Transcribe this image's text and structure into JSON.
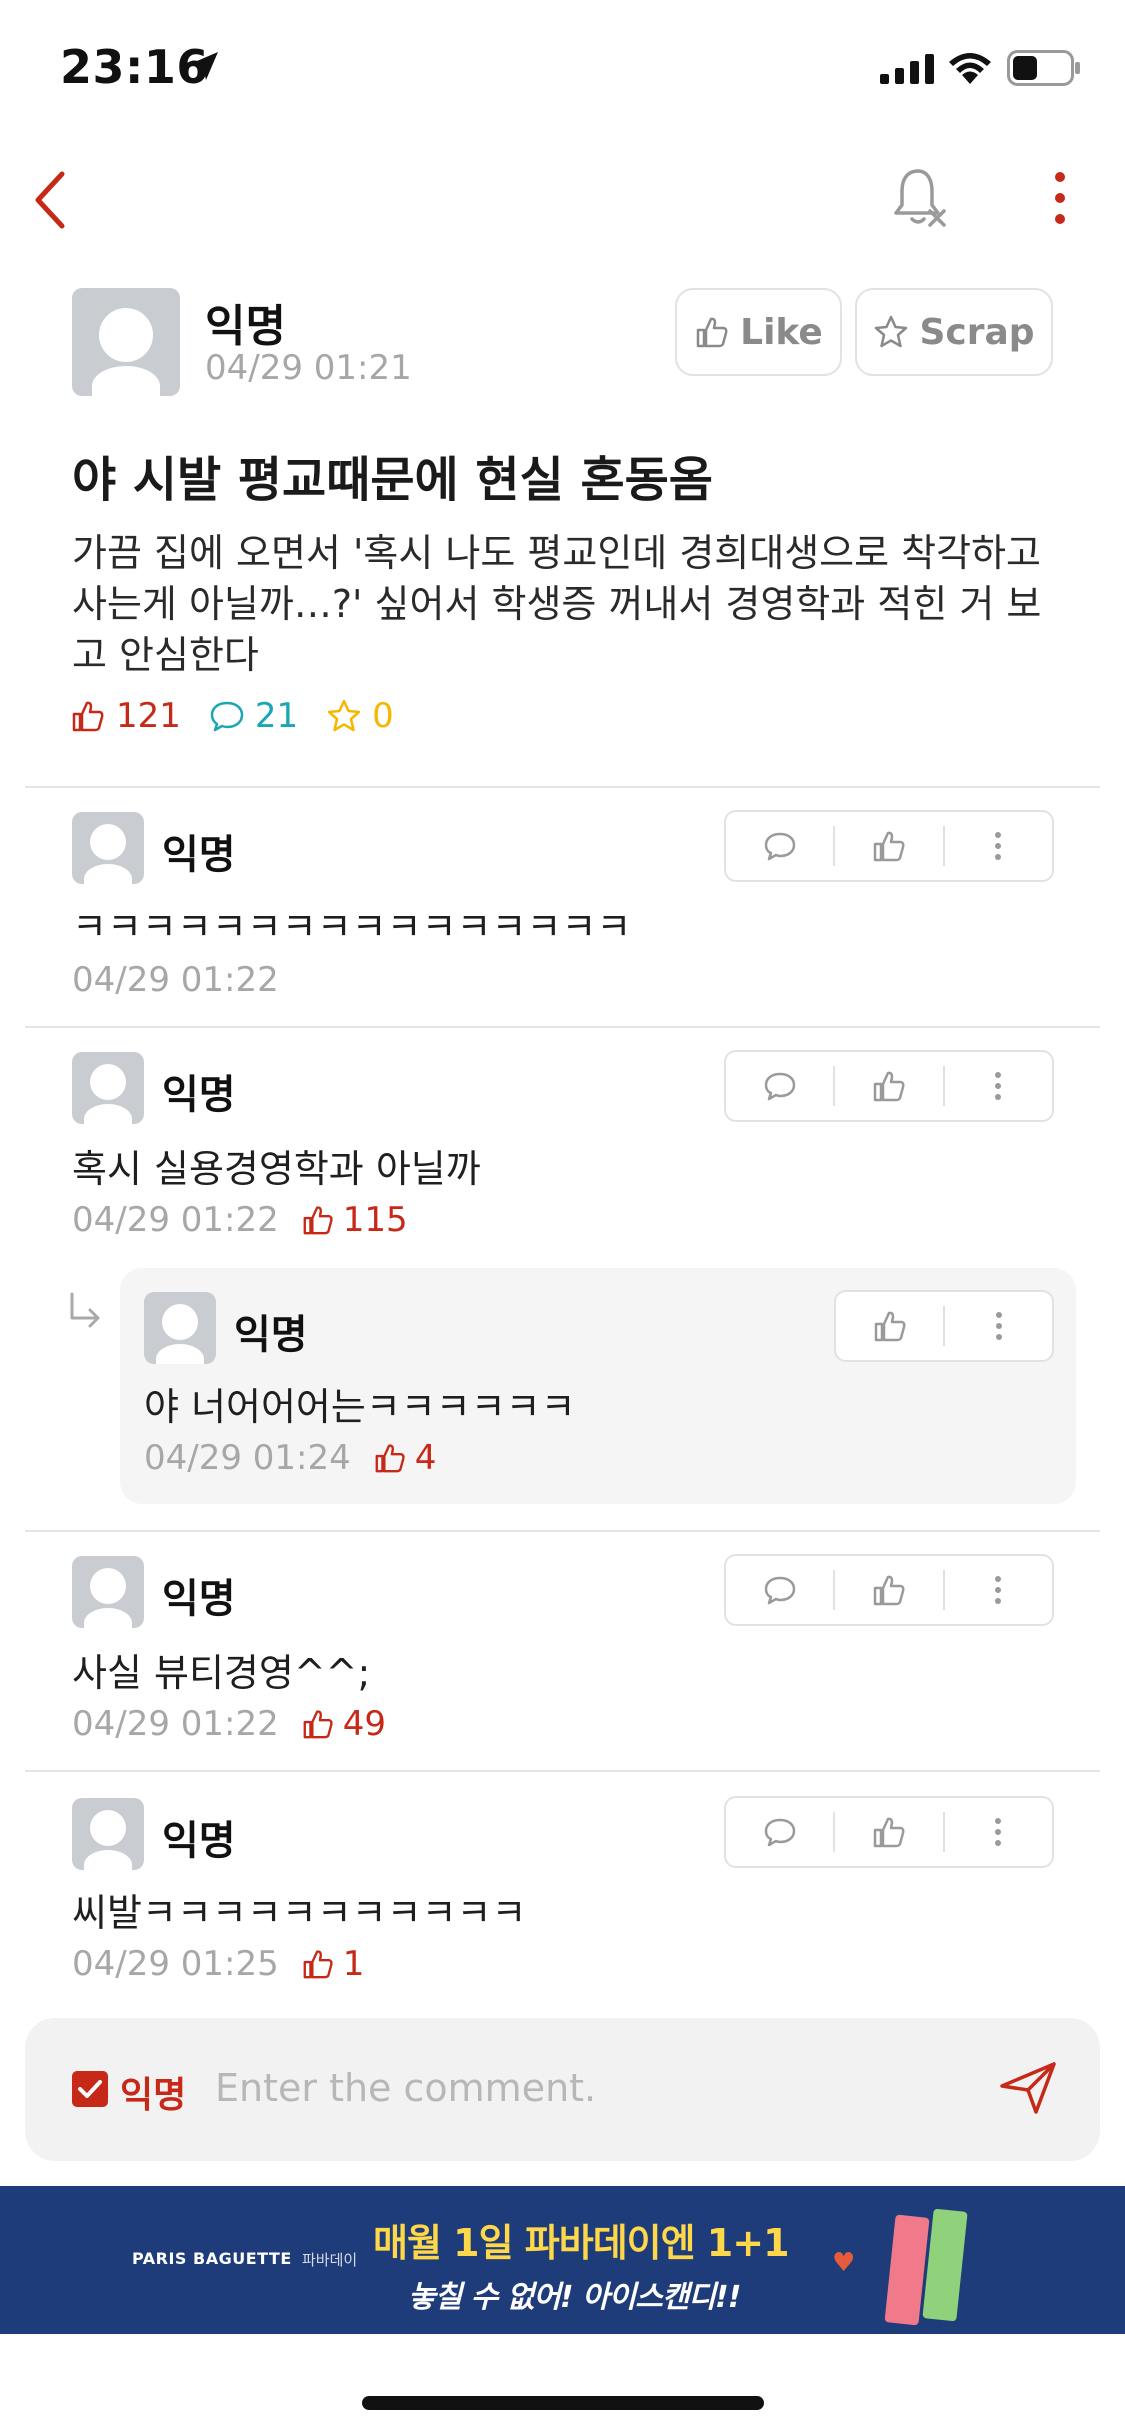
{
  "status_bar": {
    "time": "23:16"
  },
  "post": {
    "author": "익명",
    "time": "04/29 01:21",
    "like_label": "Like",
    "scrap_label": "Scrap",
    "title": "야 시발 평교때문에 현실 혼동옴",
    "body": "가끔 집에 오면서 '혹시 나도 평교인데 경희대생으로 착각하고 사는게 아닐까…?' 싶어서 학생증 꺼내서 경영학과 적힌 거 보고 안심한다",
    "likes": "121",
    "comments": "21",
    "scraps": "0"
  },
  "comments": [
    {
      "author": "익명",
      "text": "ㅋㅋㅋㅋㅋㅋㅋㅋㅋㅋㅋㅋㅋㅋㅋㅋ",
      "time": "04/29 01:22",
      "likes": ""
    },
    {
      "author": "익명",
      "text": "혹시 실용경영학과 아닐까",
      "time": "04/29 01:22",
      "likes": "115"
    },
    {
      "author": "익명",
      "text": "야 너어어어는ㅋㅋㅋㅋㅋㅋ",
      "time": "04/29 01:24",
      "likes": "4",
      "is_reply": true
    },
    {
      "author": "익명",
      "text": "사실 뷰티경영^^;",
      "time": "04/29 01:22",
      "likes": "49"
    },
    {
      "author": "익명",
      "text": "씨발ㅋㅋㅋㅋㅋㅋㅋㅋㅋㅋㅋ",
      "time": "04/29 01:25",
      "likes": "1"
    }
  ],
  "comment_input": {
    "anonymous_label": "익명",
    "anonymous_checked": true,
    "placeholder": "Enter the comment."
  },
  "ad": {
    "brand": "PARIS BAGUETTE",
    "brand_sub": "파바데이",
    "line1": "매월 1일 파바데이엔 1+1",
    "line2": "놓칠 수 없어! 아이스캔디!!"
  },
  "colors": {
    "accent_red": "#c62917",
    "comment_teal": "#1aa7b3",
    "scrap_yellow": "#f5b800",
    "muted_gray": "#a7a7a7"
  }
}
